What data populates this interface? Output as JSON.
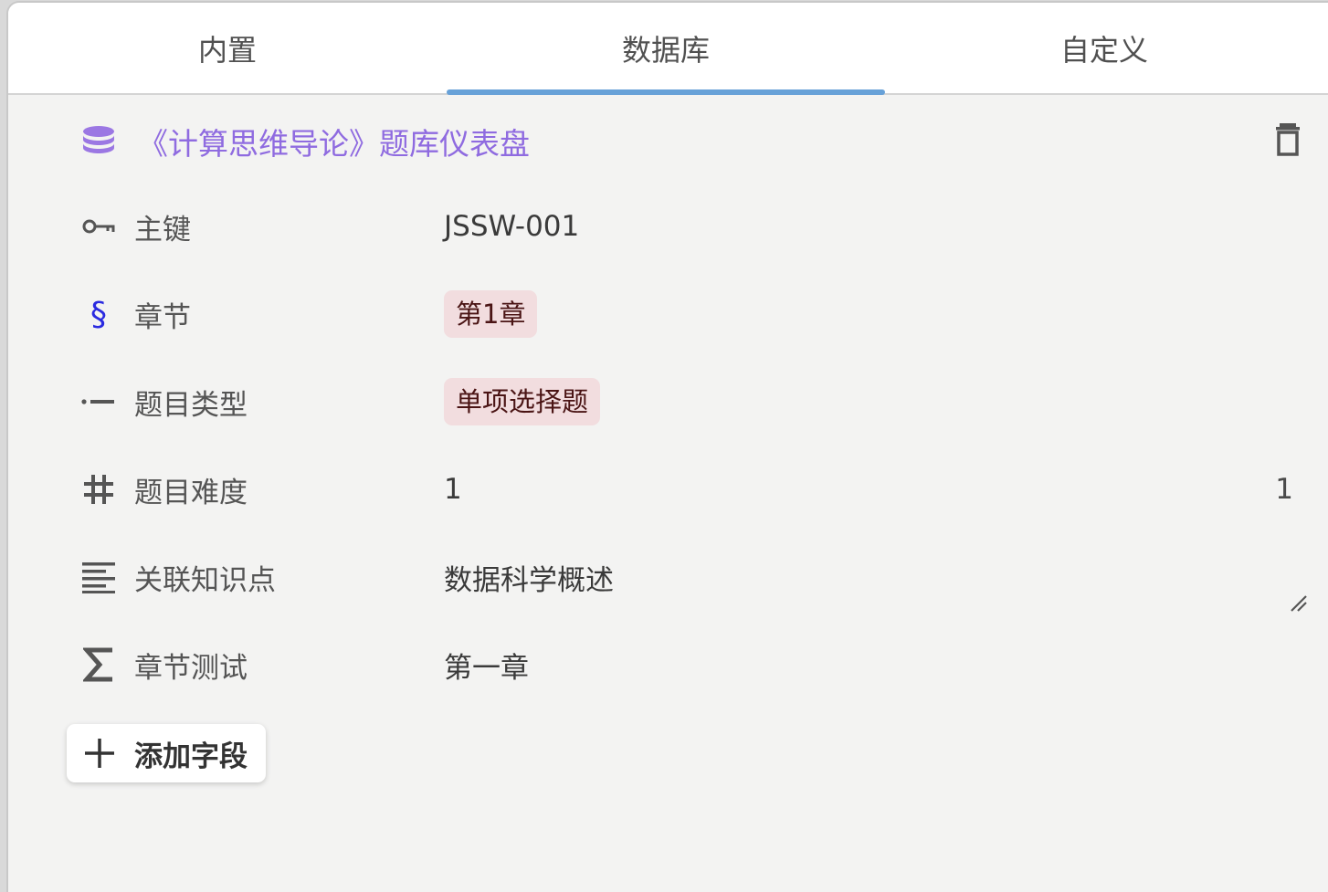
{
  "tabs": [
    {
      "label": "内置"
    },
    {
      "label": "数据库"
    },
    {
      "label": "自定义"
    }
  ],
  "active_tab": "数据库",
  "database": {
    "title": "《计算思维导论》题库仪表盘",
    "icon": "database-icon",
    "delete_icon": "trash-icon"
  },
  "fields": [
    {
      "icon": "key-icon",
      "label": "主键",
      "value": "JSSW-001",
      "type": "text"
    },
    {
      "icon": "section-icon",
      "label": "章节",
      "value": "第1章",
      "type": "tag"
    },
    {
      "icon": "select-icon",
      "label": "题目类型",
      "value": "单项选择题",
      "type": "tag"
    },
    {
      "icon": "number-icon",
      "label": "题目难度",
      "value": "1",
      "right_value": "1",
      "type": "number"
    },
    {
      "icon": "text-icon",
      "label": "关联知识点",
      "value": "数据科学概述",
      "type": "textarea"
    },
    {
      "icon": "sigma-icon",
      "label": "章节测试",
      "value": "第一章",
      "type": "formula"
    }
  ],
  "add_field": {
    "label": "添加字段",
    "icon": "plus-icon"
  },
  "colors": {
    "accent": "#67a1d8",
    "title": "#8f6be0",
    "tag_bg": "#f2dddf",
    "section_icon": "#2a2ae0"
  }
}
